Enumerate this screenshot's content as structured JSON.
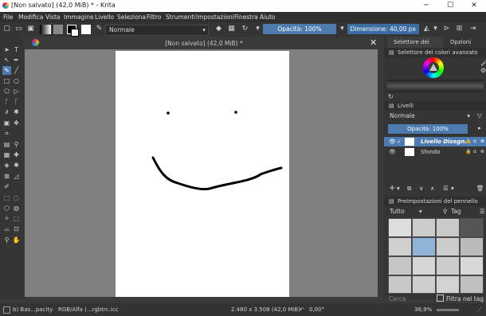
{
  "window": {
    "title": "[Non salvato] (42,0 MiB) * - Krita"
  },
  "menu": [
    "File",
    "Modifica",
    "Vista",
    "Immagine",
    "Livello",
    "Seleziona",
    "Filtro",
    "Strumenti",
    "Impostazioni",
    "Finestra",
    "Aiuto"
  ],
  "toolbar": {
    "blend_mode": "Normale",
    "opacity": "Opacità: 100%",
    "size": "Dimensione: 40,00 px"
  },
  "document": {
    "title": "[Non salvato]   (42,0 MiB) *"
  },
  "panels": {
    "tabs": [
      "Selettore dei col...",
      "Opzioni dell..."
    ],
    "color_selector_title": "Selettore dei colori avanzato",
    "layers_title": "Livelli",
    "layers_blend": "Normale",
    "layers_opacity": "Opacità:  100%",
    "layers": [
      {
        "name": "Livello Disegn...",
        "selected": true
      },
      {
        "name": "Sfondo",
        "selected": false
      }
    ],
    "brush_presets_title": "Preimpostazioni del pennello",
    "brush_filter": "Tutto",
    "brush_tag": "Tag",
    "search_placeholder": "Cerca",
    "filter_in_tag": "Filtra nel tag"
  },
  "status": {
    "brush": "b) Bas...pacity",
    "color_model": "RGB/Alfa (...rgbtrc.icc",
    "dimensions": "2.480 x 3.508 (42,0 MiB)",
    "rotation": "0,00°",
    "zoom": "36,9%"
  },
  "colors": {
    "accent": "#4d7bb0",
    "canvas_bg": "#808080",
    "panel_bg": "#353535"
  }
}
